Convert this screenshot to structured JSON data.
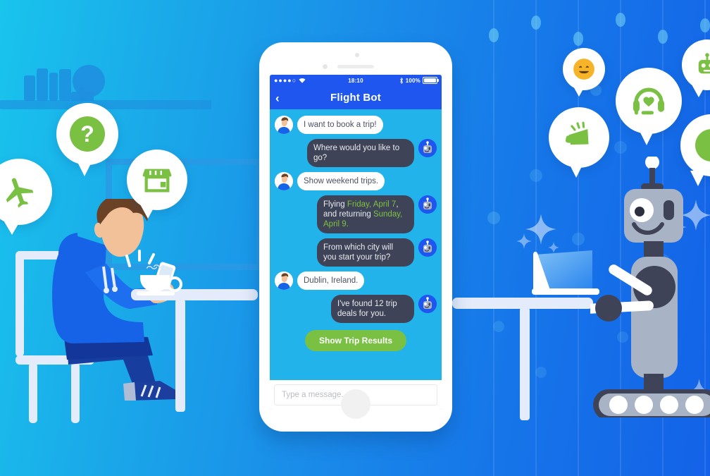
{
  "background": {
    "gradient_from": "#19c4ed",
    "gradient_to": "#1462e8"
  },
  "phone": {
    "status_bar": {
      "signal_dots": "●●●●○",
      "wifi_icon": "wifi-icon",
      "time": "18:10",
      "bluetooth_icon": "bluetooth-icon",
      "battery_percent": "100%"
    },
    "nav": {
      "back_icon": "chevron-left-icon",
      "title": "Flight Bot"
    },
    "messages": [
      {
        "from": "user",
        "text": "I want to book a trip!",
        "avatar": "user-avatar"
      },
      {
        "from": "bot",
        "text": "Where would you like to go?",
        "avatar": "bot-avatar"
      },
      {
        "from": "user",
        "text": "Show weekend trips.",
        "avatar": "user-avatar"
      },
      {
        "from": "bot",
        "text": "Flying Friday, April 7, and returning Sunday, April 9.",
        "avatar": "bot-avatar",
        "segments": [
          {
            "text": "Flying ",
            "highlight": false
          },
          {
            "text": "Friday, April 7",
            "highlight": true
          },
          {
            "text": ", and returning ",
            "highlight": false
          },
          {
            "text": "Sunday, April 9.",
            "highlight": true
          }
        ]
      },
      {
        "from": "bot",
        "text": "From which city will you start your trip?",
        "avatar": "bot-avatar"
      },
      {
        "from": "user",
        "text": "Dublin, Ireland.",
        "avatar": "user-avatar"
      },
      {
        "from": "bot",
        "text": "I've found 12 trip deals for you.",
        "avatar": "bot-avatar"
      }
    ],
    "cta_button": {
      "label": "Show Trip Results",
      "color": "#79c043"
    },
    "composer": {
      "placeholder": "Type a message..."
    },
    "home_button": "home-button",
    "colors": {
      "navbar": "#1f56f0",
      "chat_background": "#23b3eb",
      "bot_bubble": "#3f4357",
      "user_bubble": "#ffffff",
      "highlight_text": "#7dc242"
    }
  },
  "left_scene": {
    "description": "person-sitting-at-table-with-smartphone",
    "bubbles": [
      {
        "name": "airplane-bubble",
        "icon": "airplane-icon"
      },
      {
        "name": "question-bubble",
        "icon": "question-mark-icon"
      },
      {
        "name": "store-bubble",
        "icon": "storefront-icon"
      }
    ],
    "props": [
      "chair",
      "table",
      "coffee-cup",
      "wall-shelf",
      "books",
      "plant",
      "picture-frame"
    ]
  },
  "right_scene": {
    "description": "robot-at-desk-with-laptop",
    "bubbles": [
      {
        "name": "smiley-bubble",
        "icon": "smiling-face-icon"
      },
      {
        "name": "megaphone-bubble",
        "icon": "megaphone-icon"
      },
      {
        "name": "headset-heart-bubble",
        "icon": "headset-heart-icon"
      },
      {
        "name": "robot-bubble",
        "icon": "robot-icon"
      },
      {
        "name": "chat-bubble-edge",
        "icon": "green-circle-icon"
      }
    ],
    "props": [
      "robot",
      "treads",
      "laptop",
      "table",
      "sparkles"
    ]
  }
}
